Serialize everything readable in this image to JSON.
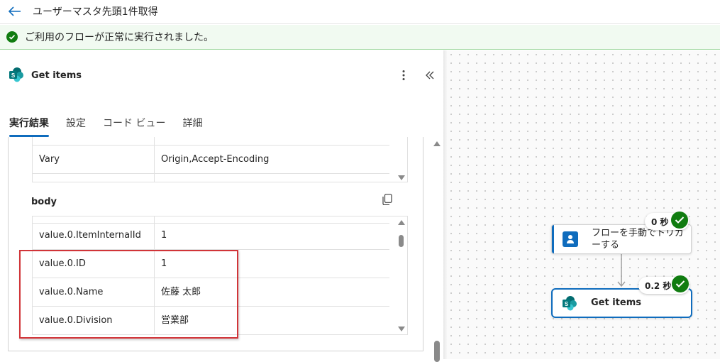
{
  "header": {
    "title": "ユーザーマスタ先頭1件取得"
  },
  "banner": {
    "text": "ご利用のフローが正常に実行されました。"
  },
  "panel": {
    "title": "Get items",
    "tabs": [
      {
        "label": "実行結果",
        "active": true
      },
      {
        "label": "設定"
      },
      {
        "label": "コード ビュー"
      },
      {
        "label": "詳細"
      }
    ],
    "headers_table": {
      "rows": [
        {
          "key": "Vary",
          "value": "Origin,Accept-Encoding"
        }
      ]
    },
    "body": {
      "label": "body",
      "rows": [
        {
          "key": "value.0.ItemInternalId",
          "value": "1"
        },
        {
          "key": "value.0.ID",
          "value": "1"
        },
        {
          "key": "value.0.Name",
          "value": "佐藤 太郎"
        },
        {
          "key": "value.0.Division",
          "value": "営業部"
        }
      ]
    }
  },
  "canvas": {
    "nodes": [
      {
        "label": "フローを手動でトリガーする",
        "duration": "0 秒"
      },
      {
        "label": "Get items",
        "duration": "0.2 秒"
      }
    ]
  },
  "colors": {
    "accent": "#0f6cbd",
    "success": "#107c10",
    "banner_bg": "#f1faf1",
    "highlight": "#d13438"
  }
}
